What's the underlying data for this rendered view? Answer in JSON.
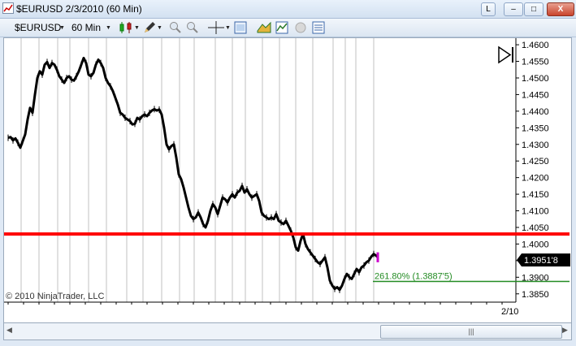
{
  "window": {
    "title": "$EURUSD  2/3/2010 (60 Min)",
    "btn_l": "L",
    "btn_min": "–",
    "btn_max": "□",
    "btn_close": "X"
  },
  "toolbar": {
    "instrument": "$EURUSD",
    "interval": "60 Min"
  },
  "chart_data": {
    "type": "line",
    "ylim": [
      1.3825,
      1.461
    ],
    "y_ticks": [
      "1.4600",
      "1.4550",
      "1.4500",
      "1.4450",
      "1.4400",
      "1.4350",
      "1.4300",
      "1.4250",
      "1.4200",
      "1.4150",
      "1.4100",
      "1.4050",
      "1.4000",
      "1.3950",
      "1.3900",
      "1.3850"
    ],
    "x_tick_label": "2/10",
    "price_series": [
      [
        0,
        1.432
      ],
      [
        3,
        1.4322
      ],
      [
        6,
        1.4312
      ],
      [
        9,
        1.4318
      ],
      [
        12,
        1.4305
      ],
      [
        15,
        1.429
      ],
      [
        18,
        1.431
      ],
      [
        21,
        1.433
      ],
      [
        24,
        1.4375
      ],
      [
        27,
        1.441
      ],
      [
        30,
        1.4395
      ],
      [
        33,
        1.445
      ],
      [
        36,
        1.45
      ],
      [
        39,
        1.452
      ],
      [
        42,
        1.451
      ],
      [
        45,
        1.454
      ],
      [
        48,
        1.4548
      ],
      [
        51,
        1.453
      ],
      [
        54,
        1.4545
      ],
      [
        57,
        1.454
      ],
      [
        60,
        1.4525
      ],
      [
        63,
        1.4505
      ],
      [
        66,
        1.4495
      ],
      [
        69,
        1.4485
      ],
      [
        72,
        1.45
      ],
      [
        75,
        1.4505
      ],
      [
        78,
        1.4495
      ],
      [
        81,
        1.4492
      ],
      [
        84,
        1.4505
      ],
      [
        87,
        1.452
      ],
      [
        90,
        1.454
      ],
      [
        93,
        1.456
      ],
      [
        96,
        1.4545
      ],
      [
        99,
        1.451
      ],
      [
        102,
        1.4505
      ],
      [
        105,
        1.4515
      ],
      [
        108,
        1.454
      ],
      [
        111,
        1.4555
      ],
      [
        114,
        1.4545
      ],
      [
        117,
        1.453
      ],
      [
        120,
        1.45
      ],
      [
        123,
        1.4485
      ],
      [
        126,
        1.4475
      ],
      [
        129,
        1.446
      ],
      [
        132,
        1.444
      ],
      [
        135,
        1.442
      ],
      [
        138,
        1.4395
      ],
      [
        141,
        1.439
      ],
      [
        144,
        1.438
      ],
      [
        147,
        1.4375
      ],
      [
        150,
        1.437
      ],
      [
        153,
        1.436
      ],
      [
        156,
        1.4362
      ],
      [
        159,
        1.438
      ],
      [
        162,
        1.4375
      ],
      [
        165,
        1.4385
      ],
      [
        168,
        1.439
      ],
      [
        171,
        1.4385
      ],
      [
        174,
        1.4395
      ],
      [
        177,
        1.4402
      ],
      [
        180,
        1.4406
      ],
      [
        183,
        1.4402
      ],
      [
        186,
        1.4405
      ],
      [
        189,
        1.439
      ],
      [
        192,
        1.435
      ],
      [
        195,
        1.43
      ],
      [
        198,
        1.4285
      ],
      [
        201,
        1.4295
      ],
      [
        204,
        1.43
      ],
      [
        207,
        1.426
      ],
      [
        210,
        1.421
      ],
      [
        213,
        1.4195
      ],
      [
        216,
        1.417
      ],
      [
        219,
        1.414
      ],
      [
        222,
        1.411
      ],
      [
        225,
        1.4085
      ],
      [
        228,
        1.4075
      ],
      [
        231,
        1.408
      ],
      [
        234,
        1.4095
      ],
      [
        237,
        1.408
      ],
      [
        240,
        1.406
      ],
      [
        243,
        1.405
      ],
      [
        246,
        1.407
      ],
      [
        249,
        1.41
      ],
      [
        252,
        1.412
      ],
      [
        255,
        1.411
      ],
      [
        258,
        1.409
      ],
      [
        261,
        1.4115
      ],
      [
        264,
        1.414
      ],
      [
        267,
        1.4135
      ],
      [
        270,
        1.4125
      ],
      [
        273,
        1.414
      ],
      [
        276,
        1.415
      ],
      [
        279,
        1.414
      ],
      [
        282,
        1.4155
      ],
      [
        285,
        1.416
      ],
      [
        288,
        1.4175
      ],
      [
        291,
        1.4155
      ],
      [
        294,
        1.4165
      ],
      [
        297,
        1.415
      ],
      [
        300,
        1.414
      ],
      [
        303,
        1.4145
      ],
      [
        306,
        1.415
      ],
      [
        309,
        1.413
      ],
      [
        312,
        1.4095
      ],
      [
        315,
        1.4085
      ],
      [
        318,
        1.408
      ],
      [
        321,
        1.4075
      ],
      [
        324,
        1.408
      ],
      [
        327,
        1.4075
      ],
      [
        330,
        1.409
      ],
      [
        333,
        1.407
      ],
      [
        336,
        1.4065
      ],
      [
        339,
        1.406
      ],
      [
        342,
        1.407
      ],
      [
        345,
        1.4055
      ],
      [
        348,
        1.404
      ],
      [
        351,
        1.402
      ],
      [
        354,
        1.399
      ],
      [
        357,
        1.398
      ],
      [
        360,
        1.401
      ],
      [
        363,
        1.403
      ],
      [
        366,
        1.4
      ],
      [
        369,
        1.3985
      ],
      [
        372,
        1.3975
      ],
      [
        375,
        1.3965
      ],
      [
        378,
        1.3955
      ],
      [
        381,
        1.3945
      ],
      [
        384,
        1.394
      ],
      [
        387,
        1.395
      ],
      [
        390,
        1.396
      ],
      [
        393,
        1.393
      ],
      [
        396,
        1.389
      ],
      [
        399,
        1.3875
      ],
      [
        402,
        1.3865
      ],
      [
        405,
        1.387
      ],
      [
        408,
        1.3862
      ],
      [
        411,
        1.3875
      ],
      [
        414,
        1.3895
      ],
      [
        417,
        1.391
      ],
      [
        420,
        1.39
      ],
      [
        423,
        1.3895
      ],
      [
        426,
        1.391
      ],
      [
        429,
        1.3925
      ],
      [
        432,
        1.3915
      ],
      [
        435,
        1.393
      ],
      [
        438,
        1.3935
      ],
      [
        441,
        1.3945
      ],
      [
        444,
        1.395
      ],
      [
        447,
        1.3962
      ],
      [
        450,
        1.397
      ],
      [
        453,
        1.3965
      ],
      [
        455,
        1.396
      ]
    ],
    "support_line": {
      "value": 1.403,
      "color": "#ff0000"
    },
    "fib_level": {
      "label": "261.80% (1.3887'5)",
      "value": 1.38875,
      "color": "#228b22"
    },
    "last_price": {
      "label": "1.3951'8",
      "value": 1.3952
    },
    "copyright": "© 2010 NinjaTrader, LLC",
    "colors": {
      "series": "#000000",
      "last_bar": "#cc00cc",
      "grid": "#c0c0c0"
    }
  }
}
